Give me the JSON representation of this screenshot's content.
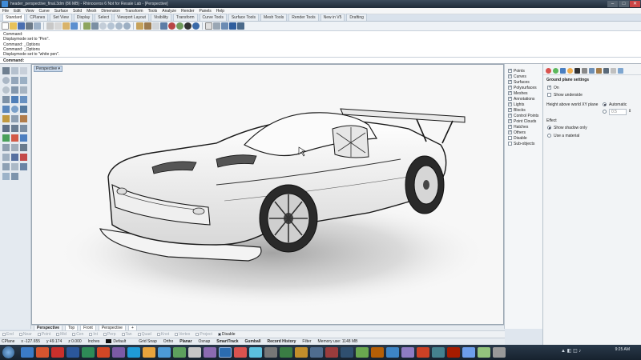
{
  "window": {
    "title": "header_perspective_final.3dm (86 MB) - Rhinoceros 6 Not for Resale Lab - [Perspective]",
    "minimize": "–",
    "maximize": "□",
    "close": "✕"
  },
  "menu": [
    "File",
    "Edit",
    "View",
    "Curve",
    "Surface",
    "Solid",
    "Mesh",
    "Dimension",
    "Transform",
    "Tools",
    "Analyze",
    "Render",
    "Panels",
    "Help"
  ],
  "toolbar_tabs": [
    "Standard",
    "CPlanes",
    "Set View",
    "Display",
    "Select",
    "Viewport Layout",
    "Visibility",
    "Transform",
    "Curve Tools",
    "Surface Tools",
    "Mesh Tools",
    "Render Tools",
    "New in V5",
    "Drafting"
  ],
  "command_history": [
    "Command:",
    "Displaymode set to \"Pen\".",
    "Command: _Options",
    "Command: _Options",
    "Displaymode set to \"white pen\"."
  ],
  "command_prompt": "Command:",
  "viewport": {
    "label": "Perspective ▾"
  },
  "viewport_tabs": [
    "Perspective",
    "Top",
    "Front",
    "Perspective",
    "+"
  ],
  "osnaps": [
    "End",
    "Near",
    "Point",
    "Mid",
    "Cen",
    "Int",
    "Perp",
    "Tan",
    "Quad",
    "Knot",
    "Vertex",
    "Project",
    "Disable"
  ],
  "status_bar": {
    "cplane": "CPlane",
    "x": "x -127.655",
    "y": "y 49.174",
    "z": "z 0.000",
    "units": "Inches",
    "layer": "Default",
    "grid_snap": "Grid Snap",
    "ortho": "Ortho",
    "planar": "Planar",
    "osnap": "Osnap",
    "smarttrack": "SmartTrack",
    "gumball": "Gumball",
    "record_history": "Record History",
    "filter": "Filter",
    "memory": "Memory use: 1148 MB"
  },
  "filter_items": [
    "Points",
    "Curves",
    "Surfaces",
    "Polysurfaces",
    "Meshes",
    "Annotations",
    "Lights",
    "Blocks",
    "Control Points",
    "Point Clouds",
    "Hatches",
    "Others",
    "Disable",
    "Sub-objects"
  ],
  "filter_checked": [
    true,
    true,
    true,
    true,
    true,
    true,
    true,
    true,
    true,
    true,
    true,
    true,
    false,
    false
  ],
  "properties": {
    "section_title": "Ground plane settings",
    "on_label": "On",
    "show_underside": "Show underside",
    "height_label": "Height above world XY plane",
    "automatic": "Automatic",
    "height_value": "0.5",
    "effect_label": "Effect",
    "show_shadow": "Show shadow only",
    "use_material": "Use a material"
  },
  "taskbar": {
    "time": "9:25 AM",
    "date": ""
  }
}
